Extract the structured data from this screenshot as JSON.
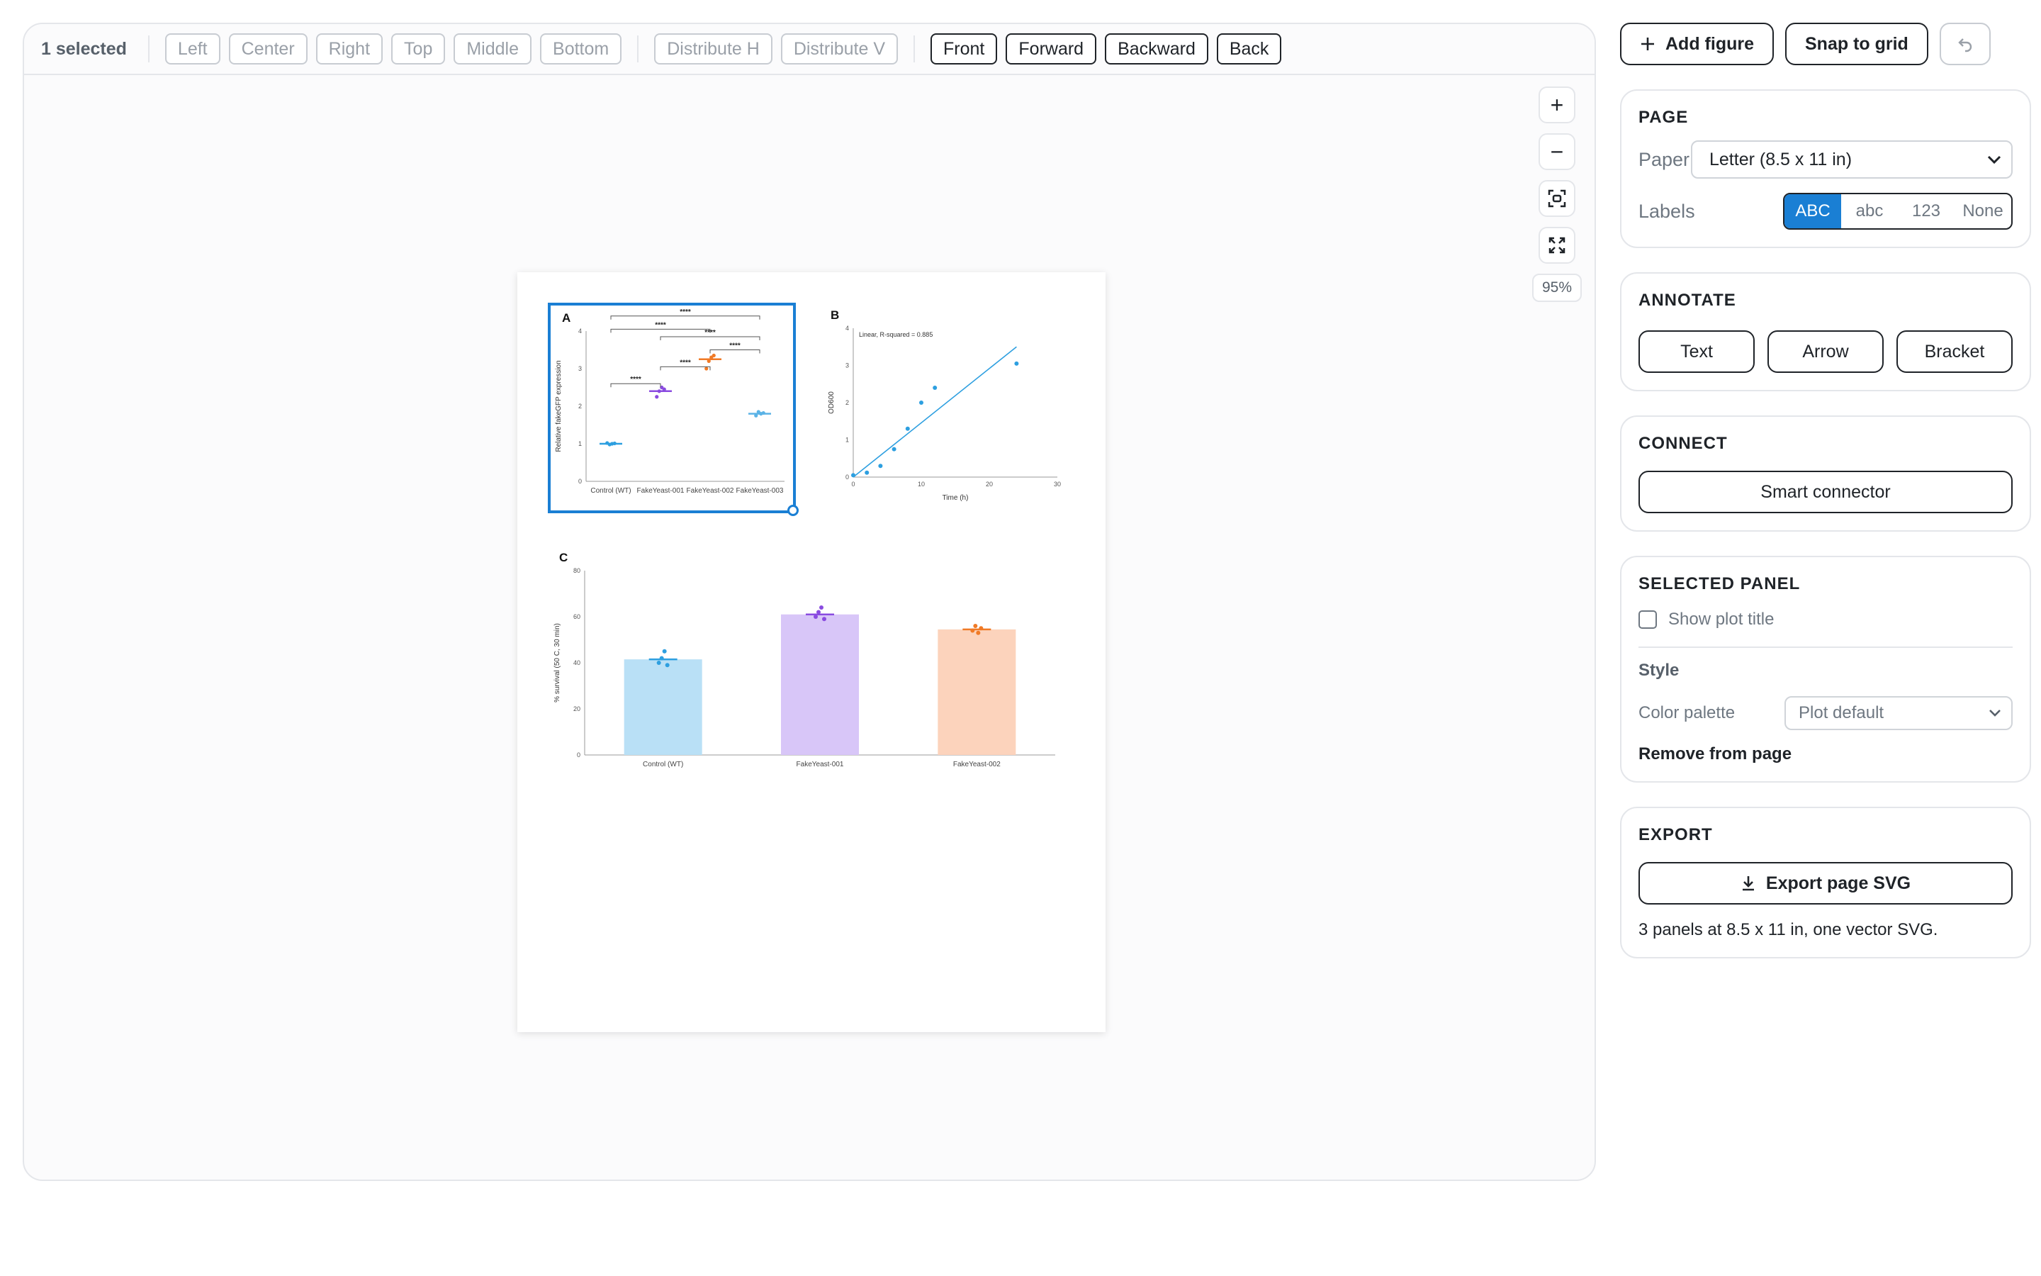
{
  "toolbar": {
    "selected": "1 selected",
    "align": [
      "Left",
      "Center",
      "Right",
      "Top",
      "Middle",
      "Bottom"
    ],
    "distribute": [
      "Distribute H",
      "Distribute V"
    ],
    "order": [
      "Front",
      "Forward",
      "Backward",
      "Back"
    ]
  },
  "zoom": {
    "level": "95%",
    "icons": [
      "plus-icon",
      "minus-icon",
      "fit-icon",
      "fullscreen-icon"
    ]
  },
  "side": {
    "add_figure": "Add figure",
    "snap_to_grid": "Snap to grid",
    "page": {
      "title": "PAGE",
      "paper_label": "Paper",
      "paper_value": "Letter (8.5 x 11 in)",
      "labels_label": "Labels",
      "label_options": [
        "ABC",
        "abc",
        "123",
        "None"
      ],
      "label_selected": "ABC"
    },
    "annotate": {
      "title": "ANNOTATE",
      "buttons": [
        "Text",
        "Arrow",
        "Bracket"
      ]
    },
    "connect": {
      "title": "CONNECT",
      "button": "Smart connector"
    },
    "selected_panel": {
      "title": "SELECTED PANEL",
      "show_plot_title": "Show plot title",
      "style": "Style",
      "color_palette_label": "Color palette",
      "color_palette_value": "Plot default",
      "remove": "Remove from page"
    },
    "export": {
      "title": "EXPORT",
      "button": "Export page SVG",
      "note": "3 panels at 8.5 x 11 in, one vector SVG."
    }
  },
  "colors": {
    "accent": "#1a7fd4",
    "blue": "#2d9fe0",
    "purple": "#8a4be0",
    "orange": "#f07a26",
    "lightblue": "#5bb3e6",
    "bar_blue": "#b9e0f6",
    "bar_purple": "#d8c6f8",
    "bar_orange": "#fcd3bc"
  },
  "panels": {
    "a_label": "A",
    "b_label": "B",
    "c_label": "C",
    "a_sig": "****",
    "b_annotation": "Linear, R-squared = 0.885"
  },
  "chart_data": [
    {
      "panel": "A",
      "type": "scatter",
      "categories": [
        "Control (WT)",
        "FakeYeast-001",
        "FakeYeast-002",
        "FakeYeast-003"
      ],
      "ylabel": "Relative fakeGFP expression",
      "ylim": [
        0,
        4
      ],
      "yticks": [
        0,
        1,
        2,
        3,
        4
      ],
      "means": [
        1.0,
        2.4,
        3.25,
        1.8
      ],
      "points": [
        [
          1.02,
          0.98,
          1.0,
          1.01
        ],
        [
          2.25,
          2.4,
          2.5,
          2.45
        ],
        [
          3.0,
          3.2,
          3.3,
          3.35
        ],
        [
          1.75,
          1.85,
          1.8,
          1.82
        ]
      ]
    },
    {
      "panel": "B",
      "type": "scatter",
      "xlabel": "Time (h)",
      "ylabel": "OD600",
      "xlim": [
        0,
        30
      ],
      "ylim": [
        0,
        4
      ],
      "xticks": [
        0,
        10,
        20,
        30
      ],
      "yticks": [
        0,
        1,
        2,
        3,
        4
      ],
      "x": [
        0,
        2,
        4,
        6,
        8,
        10,
        12,
        24
      ],
      "y": [
        0.05,
        0.12,
        0.3,
        0.75,
        1.3,
        2.0,
        2.4,
        3.05
      ],
      "fit": {
        "x": [
          0,
          24
        ],
        "y": [
          0.0,
          3.5
        ]
      }
    },
    {
      "panel": "C",
      "type": "bar",
      "categories": [
        "Control (WT)",
        "FakeYeast-001",
        "FakeYeast-002"
      ],
      "values": [
        41.5,
        61,
        54.5
      ],
      "points": [
        [
          40,
          42,
          45,
          39
        ],
        [
          60,
          62,
          64,
          59
        ],
        [
          54,
          56,
          53,
          55
        ]
      ],
      "ylabel": "% survival (50 C, 30 min)",
      "ylim": [
        0,
        80
      ],
      "yticks": [
        0,
        20,
        40,
        60,
        80
      ]
    }
  ]
}
